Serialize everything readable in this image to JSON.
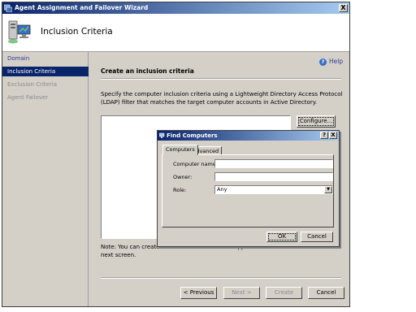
{
  "window": {
    "title": "Agent Assignment and Failover Wizard",
    "close_label": "X"
  },
  "header": {
    "title": "Inclusion Criteria"
  },
  "sidebar": {
    "items": [
      {
        "label": "Domain",
        "state": "link"
      },
      {
        "label": "Inclusion Criteria",
        "state": "active"
      },
      {
        "label": "Exclusion Criteria",
        "state": "disabled"
      },
      {
        "label": "Agent Failover",
        "state": "disabled"
      }
    ]
  },
  "content": {
    "help_label": "Help",
    "help_icon_glyph": "?",
    "section_title": "Create an inclusion criteria",
    "description": "Specify the computer inclusion criteria using a Lightweight Directory Access Protocol (LDAP) filter that matches the target computer accounts in Active Directory.",
    "filter_value": "",
    "configure_label": "Configure...",
    "note": "Note: You can create an exclusion criteria that applies to this inclusion criteria in the next screen."
  },
  "buttons": {
    "previous": "< Previous",
    "next": "Next >",
    "create": "Create",
    "cancel": "Cancel"
  },
  "dialog": {
    "title": "Find Computers",
    "help_glyph": "?",
    "close_glyph": "X",
    "tabs": [
      "Computers",
      "Advanced"
    ],
    "fields": {
      "computer_name_label": "Computer name:",
      "computer_name_value": "",
      "owner_label": "Owner:",
      "owner_value": "",
      "role_label": "Role:",
      "role_value": "Any"
    },
    "ok_label": "OK",
    "cancel_label": "Cancel"
  },
  "colors": {
    "titlebar_start": "#0a246a",
    "titlebar_end": "#a6caf0",
    "link": "#2a3d9a",
    "selection": "#0a246a"
  }
}
